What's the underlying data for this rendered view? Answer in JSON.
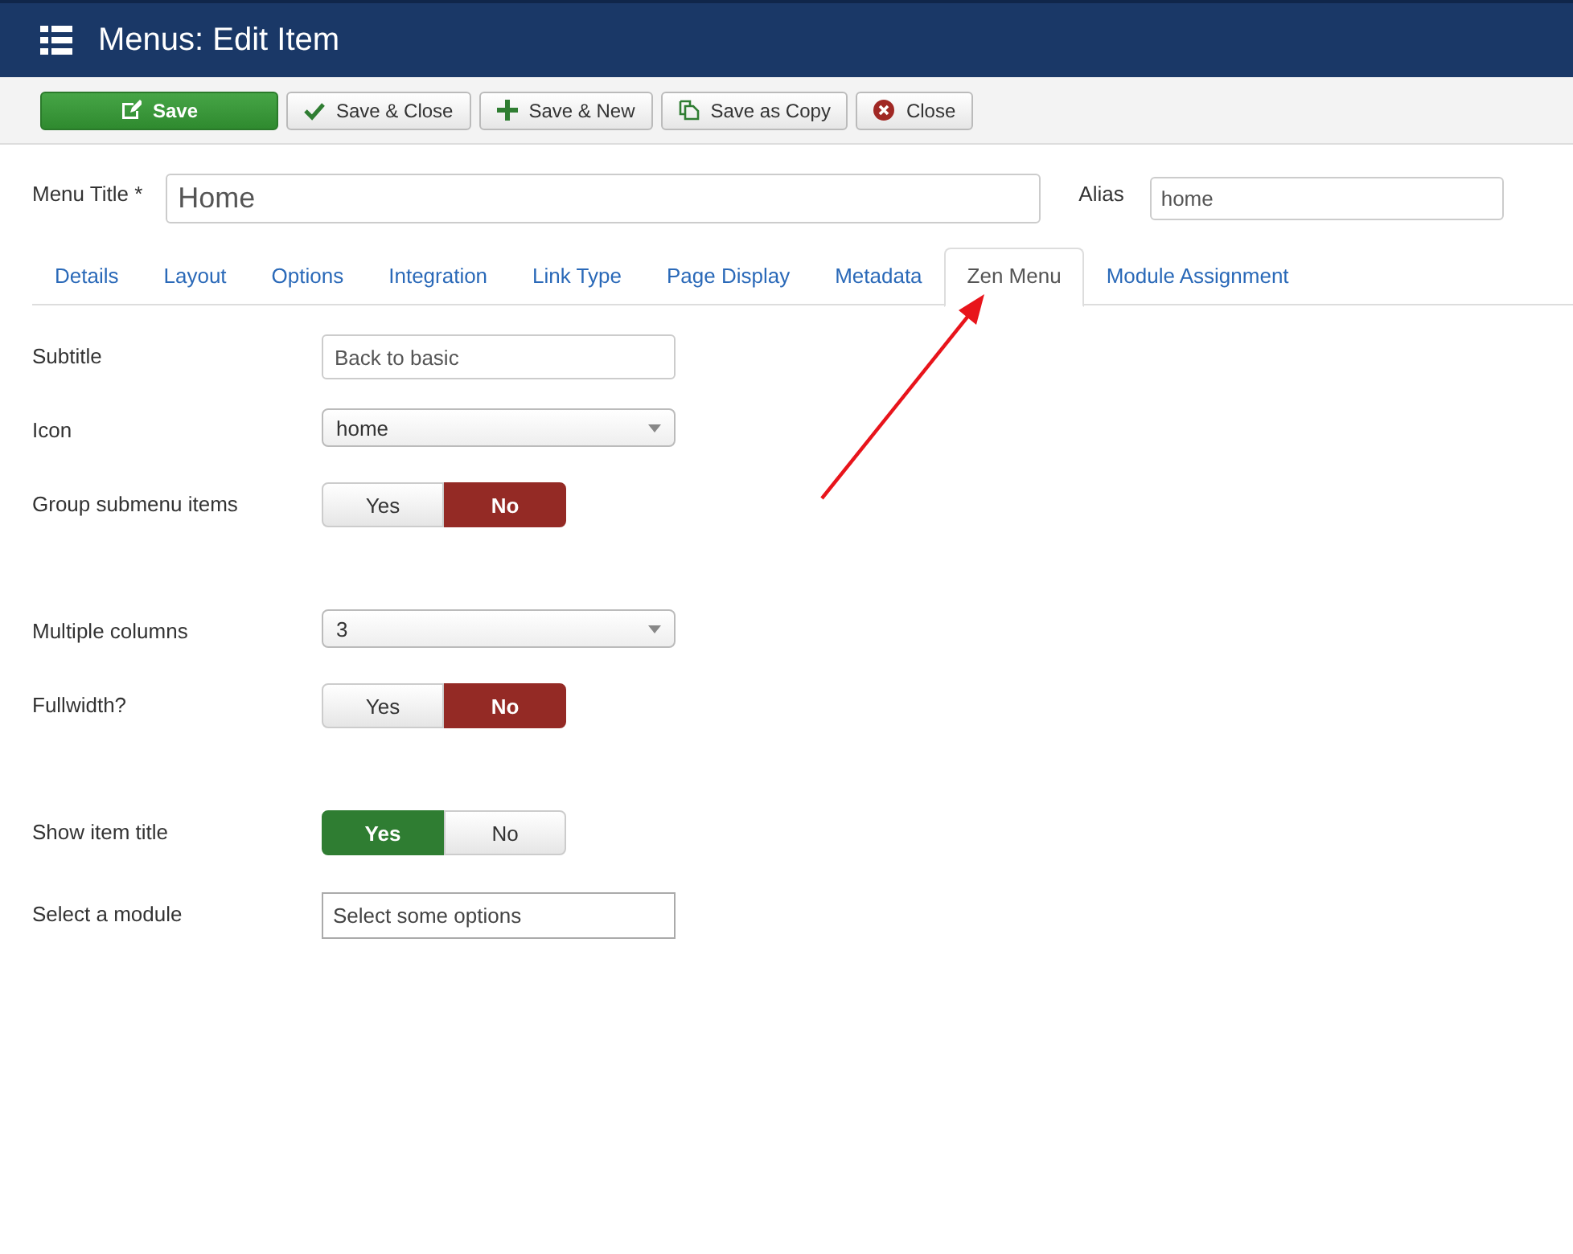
{
  "header": {
    "title": "Menus: Edit Item"
  },
  "toolbar": [
    {
      "label": "Save",
      "kind": "primary"
    },
    {
      "label": "Save & Close",
      "kind": "check"
    },
    {
      "label": "Save & New",
      "kind": "plus"
    },
    {
      "label": "Save as Copy",
      "kind": "copy"
    },
    {
      "label": "Close",
      "kind": "close"
    }
  ],
  "menu_title": {
    "label": "Menu Title *",
    "value": "Home"
  },
  "alias": {
    "label": "Alias",
    "value": "home"
  },
  "tabs": [
    {
      "label": "Details",
      "selected": false
    },
    {
      "label": "Layout",
      "selected": false
    },
    {
      "label": "Options",
      "selected": false
    },
    {
      "label": "Integration",
      "selected": false
    },
    {
      "label": "Link Type",
      "selected": false
    },
    {
      "label": "Page Display",
      "selected": false
    },
    {
      "label": "Metadata",
      "selected": false
    },
    {
      "label": "Zen Menu",
      "selected": true
    },
    {
      "label": "Module Assignment",
      "selected": false
    }
  ],
  "fields": [
    {
      "label": "Subtitle",
      "kind": "text",
      "value": "Back to basic"
    },
    {
      "label": "Icon",
      "kind": "select",
      "value": "home"
    },
    {
      "label": "Group submenu items",
      "kind": "toggle",
      "options": [
        {
          "label": "Yes",
          "selected": false,
          "kind": "yes"
        },
        {
          "label": "No",
          "selected": true,
          "kind": "no"
        }
      ]
    },
    {
      "label": "Multiple columns",
      "kind": "select",
      "value": "3"
    },
    {
      "label": "Fullwidth?",
      "kind": "toggle",
      "options": [
        {
          "label": "Yes",
          "selected": false,
          "kind": "yes"
        },
        {
          "label": "No",
          "selected": true,
          "kind": "no"
        }
      ]
    },
    {
      "label": "Show item title",
      "kind": "toggle",
      "options": [
        {
          "label": "Yes",
          "selected": true,
          "kind": "yes"
        },
        {
          "label": "No",
          "selected": false,
          "kind": "no"
        }
      ]
    },
    {
      "label": "Select a module",
      "kind": "multiselect",
      "placeholder": "Select some options"
    }
  ]
}
